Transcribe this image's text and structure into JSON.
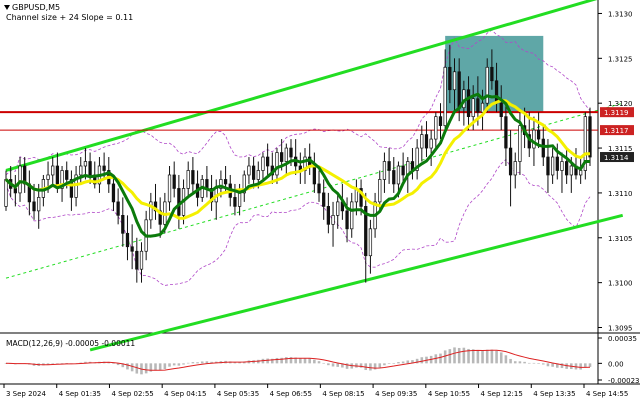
{
  "header": {
    "symbol": "GBPUSD,M5",
    "subtitle": "Channel size + 24 Slope = 0.11"
  },
  "indicator": {
    "label": "MACD(12,26,9) -0.00005 -0.00011"
  },
  "colors": {
    "bull": "#111111",
    "bear": "#111111",
    "ma_fast": "#0b7a0b",
    "ma_slow": "#f4f000",
    "band": "#b048c8",
    "channel": "#22dd22",
    "resistance": "#cc0000",
    "highlight": "#2a8a8a",
    "macd_hist": "#b8b8b8",
    "macd_signal": "#dd2222",
    "price_badge": "#cc2222",
    "current_badge": "#222222"
  },
  "chart_data": {
    "type": "candlestick",
    "symbol": "GBPUSD",
    "timeframe": "M5",
    "ylim": [
      1.30945,
      1.31315
    ],
    "y_ticks": [
      "1.3130",
      "1.3125",
      "1.3120",
      "1.3115",
      "1.3110",
      "1.3105",
      "1.3100",
      "1.3095"
    ],
    "x_ticks": [
      "3 Sep 2024",
      "4 Sep 01:35",
      "4 Sep 02:55",
      "4 Sep 04:15",
      "4 Sep 05:35",
      "4 Sep 06:55",
      "4 Sep 08:15",
      "4 Sep 09:35",
      "4 Sep 10:55",
      "4 Sep 12:15",
      "4 Sep 13:35",
      "4 Sep 14:55"
    ],
    "price_labels": [
      {
        "text": "1.3119",
        "value": 1.3119,
        "style": "badge"
      },
      {
        "text": "1.3117",
        "value": 1.3117,
        "style": "badge"
      },
      {
        "text": "1.3114",
        "value": 1.3114,
        "style": "current"
      }
    ],
    "resistance_level": 1.3119,
    "lower_reference_level": 1.3117,
    "highlight_zone": {
      "from_bar": 94,
      "to_bar": 115,
      "top": 1.31275,
      "bottom": 1.3119
    },
    "channel": {
      "upper": {
        "start": [
          0,
          1.31125
        ],
        "end": [
          132,
          1.31325
        ]
      },
      "lower": {
        "start": [
          18,
          1.30925
        ],
        "end": [
          132,
          1.31075
        ]
      },
      "mid": {
        "start": [
          0,
          1.31005
        ],
        "end": [
          132,
          1.312
        ]
      }
    },
    "ohlc": [
      [
        1.31085,
        1.31125,
        1.3108,
        1.31115
      ],
      [
        1.31115,
        1.3113,
        1.31095,
        1.31105
      ],
      [
        1.31105,
        1.3112,
        1.31085,
        1.311
      ],
      [
        1.311,
        1.3114,
        1.3109,
        1.3113
      ],
      [
        1.3113,
        1.3114,
        1.311,
        1.3111
      ],
      [
        1.3111,
        1.31125,
        1.31075,
        1.3109
      ],
      [
        1.3109,
        1.3111,
        1.3107,
        1.3108
      ],
      [
        1.3108,
        1.3111,
        1.3106,
        1.31095
      ],
      [
        1.31095,
        1.3112,
        1.31085,
        1.31115
      ],
      [
        1.31115,
        1.31135,
        1.311,
        1.3112
      ],
      [
        1.3112,
        1.3114,
        1.3111,
        1.3113
      ],
      [
        1.3113,
        1.31145,
        1.311,
        1.31105
      ],
      [
        1.31105,
        1.3113,
        1.3109,
        1.31125
      ],
      [
        1.31125,
        1.31135,
        1.31105,
        1.31115
      ],
      [
        1.31115,
        1.31125,
        1.3108,
        1.31095
      ],
      [
        1.31095,
        1.3113,
        1.31085,
        1.3112
      ],
      [
        1.3112,
        1.3114,
        1.3111,
        1.3113
      ],
      [
        1.3113,
        1.3115,
        1.31115,
        1.31135
      ],
      [
        1.31135,
        1.31145,
        1.3111,
        1.3112
      ],
      [
        1.3112,
        1.31135,
        1.31105,
        1.3111
      ],
      [
        1.3111,
        1.3114,
        1.311,
        1.3113
      ],
      [
        1.3113,
        1.31145,
        1.31115,
        1.31125
      ],
      [
        1.31125,
        1.3114,
        1.311,
        1.3111
      ],
      [
        1.3111,
        1.3112,
        1.3108,
        1.3109
      ],
      [
        1.3109,
        1.31105,
        1.31065,
        1.31075
      ],
      [
        1.31075,
        1.31095,
        1.3104,
        1.31055
      ],
      [
        1.31055,
        1.31075,
        1.31025,
        1.3104
      ],
      [
        1.3104,
        1.31065,
        1.31015,
        1.31035
      ],
      [
        1.31035,
        1.3105,
        1.31,
        1.31015
      ],
      [
        1.31015,
        1.31045,
        1.31,
        1.31035
      ],
      [
        1.31035,
        1.3108,
        1.31025,
        1.3107
      ],
      [
        1.3107,
        1.311,
        1.3106,
        1.3109
      ],
      [
        1.3109,
        1.3111,
        1.3107,
        1.3108
      ],
      [
        1.3108,
        1.31095,
        1.3105,
        1.31065
      ],
      [
        1.31065,
        1.311,
        1.31055,
        1.3109
      ],
      [
        1.3109,
        1.3113,
        1.3108,
        1.3112
      ],
      [
        1.3112,
        1.31135,
        1.31095,
        1.31105
      ],
      [
        1.31105,
        1.3112,
        1.3106,
        1.31075
      ],
      [
        1.31075,
        1.31115,
        1.31065,
        1.31105
      ],
      [
        1.31105,
        1.31135,
        1.31095,
        1.31125
      ],
      [
        1.31125,
        1.3114,
        1.311,
        1.3111
      ],
      [
        1.3111,
        1.31125,
        1.31085,
        1.31095
      ],
      [
        1.31095,
        1.3112,
        1.3109,
        1.31115
      ],
      [
        1.31115,
        1.3113,
        1.31095,
        1.31105
      ],
      [
        1.31105,
        1.3112,
        1.3108,
        1.3109
      ],
      [
        1.3109,
        1.31115,
        1.3107,
        1.31105
      ],
      [
        1.31105,
        1.31125,
        1.31095,
        1.31115
      ],
      [
        1.31115,
        1.3113,
        1.311,
        1.3111
      ],
      [
        1.3111,
        1.3112,
        1.31085,
        1.31095
      ],
      [
        1.31095,
        1.3111,
        1.31075,
        1.31085
      ],
      [
        1.31085,
        1.3111,
        1.31075,
        1.311
      ],
      [
        1.311,
        1.31125,
        1.3109,
        1.3112
      ],
      [
        1.3112,
        1.3114,
        1.3111,
        1.3113
      ],
      [
        1.3113,
        1.3114,
        1.31105,
        1.31115
      ],
      [
        1.31115,
        1.31135,
        1.31105,
        1.31125
      ],
      [
        1.31125,
        1.31145,
        1.31115,
        1.3114
      ],
      [
        1.3114,
        1.31155,
        1.3112,
        1.3113
      ],
      [
        1.3113,
        1.31145,
        1.3111,
        1.3112
      ],
      [
        1.3112,
        1.3115,
        1.3111,
        1.31145
      ],
      [
        1.31145,
        1.3116,
        1.31125,
        1.31135
      ],
      [
        1.31135,
        1.31155,
        1.3112,
        1.3115
      ],
      [
        1.3115,
        1.3116,
        1.3113,
        1.3114
      ],
      [
        1.3114,
        1.3116,
        1.3112,
        1.3113
      ],
      [
        1.3113,
        1.31145,
        1.3111,
        1.31125
      ],
      [
        1.31125,
        1.3115,
        1.3111,
        1.3114
      ],
      [
        1.3114,
        1.31155,
        1.3112,
        1.3113
      ],
      [
        1.3113,
        1.31145,
        1.311,
        1.3111
      ],
      [
        1.3111,
        1.31125,
        1.3109,
        1.311
      ],
      [
        1.311,
        1.31115,
        1.3107,
        1.31085
      ],
      [
        1.31085,
        1.311,
        1.31055,
        1.31065
      ],
      [
        1.31065,
        1.3109,
        1.3104,
        1.31075
      ],
      [
        1.31075,
        1.311,
        1.3106,
        1.3109
      ],
      [
        1.3109,
        1.3111,
        1.3107,
        1.3108
      ],
      [
        1.3108,
        1.31095,
        1.31045,
        1.3106
      ],
      [
        1.3106,
        1.311,
        1.3105,
        1.3109
      ],
      [
        1.3109,
        1.31115,
        1.31075,
        1.31105
      ],
      [
        1.31105,
        1.31115,
        1.31075,
        1.31085
      ],
      [
        1.31085,
        1.311,
        1.31,
        1.3103
      ],
      [
        1.3103,
        1.3107,
        1.3101,
        1.3106
      ],
      [
        1.3106,
        1.311,
        1.3105,
        1.3109
      ],
      [
        1.3109,
        1.31125,
        1.3108,
        1.31115
      ],
      [
        1.31115,
        1.31145,
        1.311,
        1.31135
      ],
      [
        1.31135,
        1.3115,
        1.3111,
        1.31125
      ],
      [
        1.31125,
        1.3114,
        1.311,
        1.3111
      ],
      [
        1.3111,
        1.31135,
        1.31095,
        1.3113
      ],
      [
        1.3113,
        1.31145,
        1.3111,
        1.3112
      ],
      [
        1.3112,
        1.3114,
        1.311,
        1.31135
      ],
      [
        1.31135,
        1.3115,
        1.31115,
        1.31125
      ],
      [
        1.31125,
        1.3116,
        1.31115,
        1.3115
      ],
      [
        1.3115,
        1.31175,
        1.31135,
        1.31165
      ],
      [
        1.31165,
        1.3118,
        1.3114,
        1.3115
      ],
      [
        1.3115,
        1.3117,
        1.3113,
        1.3116
      ],
      [
        1.3116,
        1.3119,
        1.3115,
        1.31185
      ],
      [
        1.31185,
        1.312,
        1.3116,
        1.31175
      ],
      [
        1.31175,
        1.3126,
        1.3117,
        1.3124
      ],
      [
        1.3124,
        1.31265,
        1.312,
        1.31215
      ],
      [
        1.31215,
        1.3125,
        1.3119,
        1.31235
      ],
      [
        1.31235,
        1.3125,
        1.3118,
        1.31195
      ],
      [
        1.31195,
        1.31225,
        1.31175,
        1.31215
      ],
      [
        1.31215,
        1.3123,
        1.3117,
        1.31185
      ],
      [
        1.31185,
        1.3122,
        1.3117,
        1.31205
      ],
      [
        1.31205,
        1.3123,
        1.31175,
        1.3119
      ],
      [
        1.3119,
        1.31215,
        1.3117,
        1.312
      ],
      [
        1.312,
        1.3125,
        1.3119,
        1.3124
      ],
      [
        1.3124,
        1.3126,
        1.31215,
        1.31225
      ],
      [
        1.31225,
        1.31245,
        1.3119,
        1.312
      ],
      [
        1.312,
        1.3122,
        1.3117,
        1.31185
      ],
      [
        1.31185,
        1.312,
        1.3113,
        1.3115
      ],
      [
        1.3115,
        1.3117,
        1.31085,
        1.3112
      ],
      [
        1.3112,
        1.31145,
        1.31105,
        1.31135
      ],
      [
        1.31135,
        1.3119,
        1.3112,
        1.31175
      ],
      [
        1.31175,
        1.31195,
        1.3115,
        1.31165
      ],
      [
        1.31165,
        1.3119,
        1.3114,
        1.3115
      ],
      [
        1.3115,
        1.31185,
        1.3113,
        1.3117
      ],
      [
        1.3117,
        1.3119,
        1.3115,
        1.3116
      ],
      [
        1.3116,
        1.31175,
        1.3113,
        1.3114
      ],
      [
        1.3114,
        1.3116,
        1.311,
        1.3112
      ],
      [
        1.3112,
        1.3115,
        1.3111,
        1.3114
      ],
      [
        1.3114,
        1.31155,
        1.31115,
        1.31125
      ],
      [
        1.31125,
        1.31145,
        1.311,
        1.31135
      ],
      [
        1.31135,
        1.3115,
        1.3111,
        1.3112
      ],
      [
        1.3112,
        1.3114,
        1.311,
        1.3113
      ],
      [
        1.3113,
        1.3115,
        1.31115,
        1.3112
      ],
      [
        1.3112,
        1.3114,
        1.3111,
        1.31125
      ],
      [
        1.31125,
        1.3119,
        1.31115,
        1.31185
      ],
      [
        1.31185,
        1.31195,
        1.3113,
        1.3114
      ]
    ],
    "macd": {
      "label": "MACD(12,26,9)",
      "main": -5e-05,
      "signal": -0.00011,
      "ylim": [
        -0.00023,
        0.00035
      ],
      "y_ticks": [
        "0.00035",
        "0.00",
        "-0.00023"
      ]
    }
  }
}
